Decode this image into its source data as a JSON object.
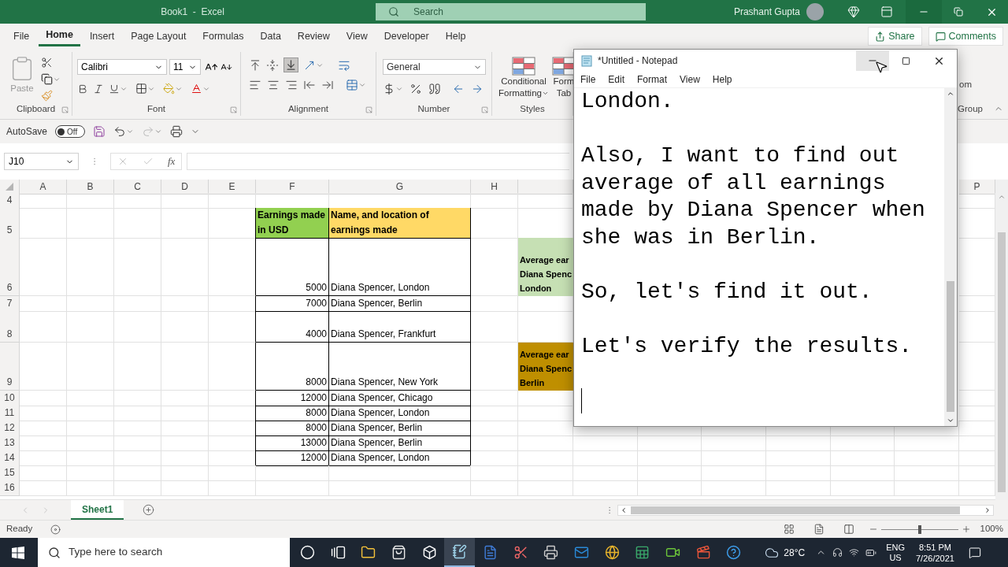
{
  "excel": {
    "title": "Book1  -  Excel",
    "search": {
      "placeholder": "Search"
    },
    "user": {
      "name": "Prashant Gupta"
    },
    "tabs": [
      {
        "label": "File",
        "selected": false
      },
      {
        "label": "Home",
        "selected": true
      },
      {
        "label": "Insert",
        "selected": false
      },
      {
        "label": "Page Layout",
        "selected": false
      },
      {
        "label": "Formulas",
        "selected": false
      },
      {
        "label": "Data",
        "selected": false
      },
      {
        "label": "Review",
        "selected": false
      },
      {
        "label": "View",
        "selected": false
      },
      {
        "label": "Developer",
        "selected": false
      },
      {
        "label": "Help",
        "selected": false
      }
    ],
    "share": "Share",
    "comments": "Comments",
    "ribbon": {
      "groups": [
        {
          "kind": "clipboard",
          "label": "Clipboard",
          "paste": "Paste"
        },
        {
          "kind": "font",
          "label": "Font",
          "font_name": "Calibri",
          "font_size": "11"
        },
        {
          "kind": "alignment",
          "label": "Alignment"
        },
        {
          "kind": "number",
          "label": "Number",
          "format": "General"
        },
        {
          "kind": "styles",
          "label": "Styles",
          "buttons": [
            {
              "lines": [
                "Conditional",
                "Formatting"
              ],
              "dropdown": true
            },
            {
              "lines": [
                "Form",
                "Tab"
              ],
              "dropdown": false
            }
          ]
        }
      ],
      "right": {
        "button_fragment": "om",
        "group_fragment": "Group"
      }
    },
    "quick_access": {
      "autosave_label": "AutoSave",
      "autosave_on": false,
      "autosave_state": "Off",
      "redo_disabled": true
    },
    "formula_bar": {
      "name_box": "J10",
      "function_label": "fx"
    },
    "sheet": {
      "columns": [
        "A",
        "B",
        "C",
        "D",
        "E",
        "F",
        "G",
        "H"
      ],
      "last_column": "P",
      "rows": [
        {
          "header": "4"
        },
        {
          "header": "5",
          "earnings": {
            "text": "Earnings made in USD",
            "kind": "heading",
            "color": "#92d050"
          },
          "description": {
            "text": "Name, and location of earnings made",
            "kind": "heading",
            "color": "#ffd966"
          }
        },
        {
          "header": "6",
          "earnings": {
            "text": "5000",
            "kind": "value"
          },
          "description": {
            "text": "Diana Spencer, London",
            "kind": "value"
          },
          "summary": {
            "lines": [
              "Average ear",
              "Diana Spenc",
              "London"
            ],
            "color": "#c6e0b4"
          }
        },
        {
          "header": "7",
          "earnings": {
            "text": "7000",
            "kind": "value"
          },
          "description": {
            "text": "Diana Spencer, Berlin",
            "kind": "value"
          }
        },
        {
          "header": "8",
          "earnings": {
            "text": "4000",
            "kind": "value"
          },
          "description": {
            "text": "Diana Spencer, Frankfurt",
            "kind": "value"
          }
        },
        {
          "header": "9",
          "earnings": {
            "text": "8000",
            "kind": "value"
          },
          "description": {
            "text": "Diana Spencer, New York",
            "kind": "value"
          },
          "summary": {
            "lines": [
              "Average ear",
              "Diana Spenc",
              "Berlin"
            ],
            "color": "#bf8f00"
          }
        },
        {
          "header": "10",
          "earnings": {
            "text": "12000",
            "kind": "value"
          },
          "description": {
            "text": "Diana Spencer, Chicago",
            "kind": "value"
          }
        },
        {
          "header": "11",
          "earnings": {
            "text": "8000",
            "kind": "value"
          },
          "description": {
            "text": "Diana Spencer, London",
            "kind": "value"
          }
        },
        {
          "header": "12",
          "earnings": {
            "text": "8000",
            "kind": "value"
          },
          "description": {
            "text": "Diana Spencer, Berlin",
            "kind": "value"
          }
        },
        {
          "header": "13",
          "earnings": {
            "text": "13000",
            "kind": "value"
          },
          "description": {
            "text": "Diana Spencer, Berlin",
            "kind": "value"
          }
        },
        {
          "header": "14",
          "earnings": {
            "text": "12000",
            "kind": "value"
          },
          "description": {
            "text": "Diana Spencer, London",
            "kind": "value"
          }
        },
        {
          "header": "15"
        },
        {
          "header": "16"
        }
      ],
      "sheet_tabs": [
        {
          "label": "Sheet1",
          "selected": true
        }
      ]
    },
    "status": {
      "text": "Ready",
      "zoom_label": "100%",
      "zoom": {
        "level": 0.5
      }
    }
  },
  "notepad": {
    "title": "*Untitled - Notepad",
    "minimize_hovered": true,
    "menu": [
      "File",
      "Edit",
      "Format",
      "View",
      "Help"
    ],
    "paragraphs": [
      [
        "London."
      ],
      [
        "Also, I want to find out",
        "average of all earnings",
        "made by Diana Spencer when",
        "she was in Berlin."
      ],
      [
        "So, let's find it out."
      ],
      [
        "Let's verify the results."
      ]
    ]
  },
  "taskbar": {
    "search_placeholder": "Type here to search",
    "apps": [
      {
        "kind": "cortana",
        "selected": false
      },
      {
        "kind": "taskview",
        "selected": false
      },
      {
        "kind": "explorer",
        "selected": false
      },
      {
        "kind": "store",
        "selected": false
      },
      {
        "kind": "dropbox",
        "selected": false
      },
      {
        "kind": "notepad",
        "selected": true
      },
      {
        "kind": "word",
        "selected": false
      },
      {
        "kind": "snip",
        "selected": false
      },
      {
        "kind": "fax",
        "selected": false
      },
      {
        "kind": "outlook",
        "selected": false
      },
      {
        "kind": "chrome",
        "selected": false
      },
      {
        "kind": "excel",
        "selected": false
      },
      {
        "kind": "recorder",
        "selected": false
      },
      {
        "kind": "editor",
        "selected": false
      },
      {
        "kind": "help",
        "selected": false
      }
    ],
    "weather": "28°C",
    "language": "ENG",
    "region": "US",
    "time": "8:51 PM",
    "date": "7/26/2021"
  }
}
